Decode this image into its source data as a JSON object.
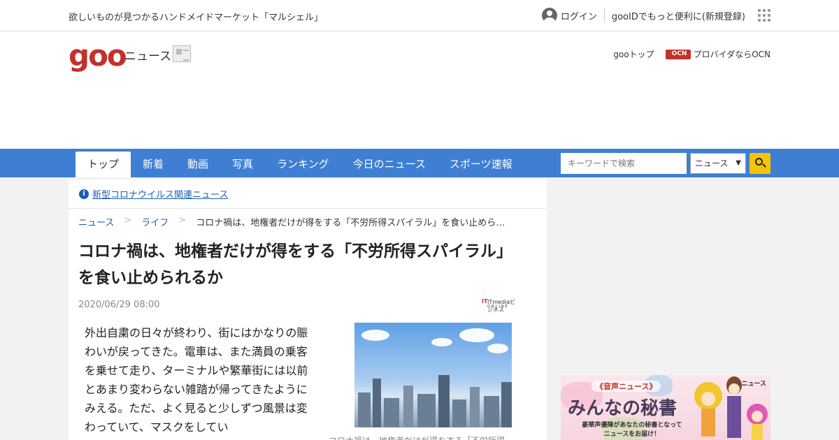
{
  "topbar": {
    "promo": "欲しいものが見つかるハンドメイドマーケット「マルシェル」",
    "login": "ログイン",
    "register": "gooIDでもっと便利に(新規登録)"
  },
  "header": {
    "logo": "goo",
    "section": "ニュース",
    "link_top": "gooトップ",
    "link_ocn": "プロバイダならOCN"
  },
  "nav": {
    "tabs": [
      "トップ",
      "新着",
      "動画",
      "写真",
      "ランキング",
      "今日のニュース",
      "スポーツ速報"
    ],
    "search_placeholder": "キーワードで検索",
    "search_scope": "ニュース"
  },
  "notice": {
    "icon": "info-icon",
    "text": "新型コロナウイルス関連ニュース"
  },
  "breadcrumb": [
    "ニュース",
    "ライフ",
    "コロナ禍は、地権者だけが得をする「不労所得スパイラル」を食い止めら…"
  ],
  "article": {
    "title": "コロナ禍は、地権者だけが得をする「不労所得スパイラル」を食い止められるか",
    "date": "2020/06/29 08:00",
    "source": "ITmediaビジネス",
    "source_sub": "ONLINE",
    "body": "外出自粛の日々が終わり、街にはかなりの賑わいが戻ってきた。電車は、また満員の乗客を乗せて走り、ターミナルや繁華街には以前とあまり変わらない雑踏が帰ってきたようにみえる。ただ、よく見ると少しずつ風景は変わっていて、マスクをしてい",
    "caption": "コロナ禍は、地権者だけが得をする「不労所得"
  },
  "side_ad": {
    "brand": "goo",
    "brand_suffix": "ニュース",
    "tag": "《音声ニュース》",
    "headline": "みんなの秘書",
    "desc_line1": "豪華声優陣があなたの秘書となって",
    "desc_line2": "ニュースをお届け！"
  },
  "colors": {
    "nav": "#3f7fd3",
    "brand_red": "#c4312b",
    "link": "#1a5fb4",
    "search_button": "#f5c400"
  }
}
